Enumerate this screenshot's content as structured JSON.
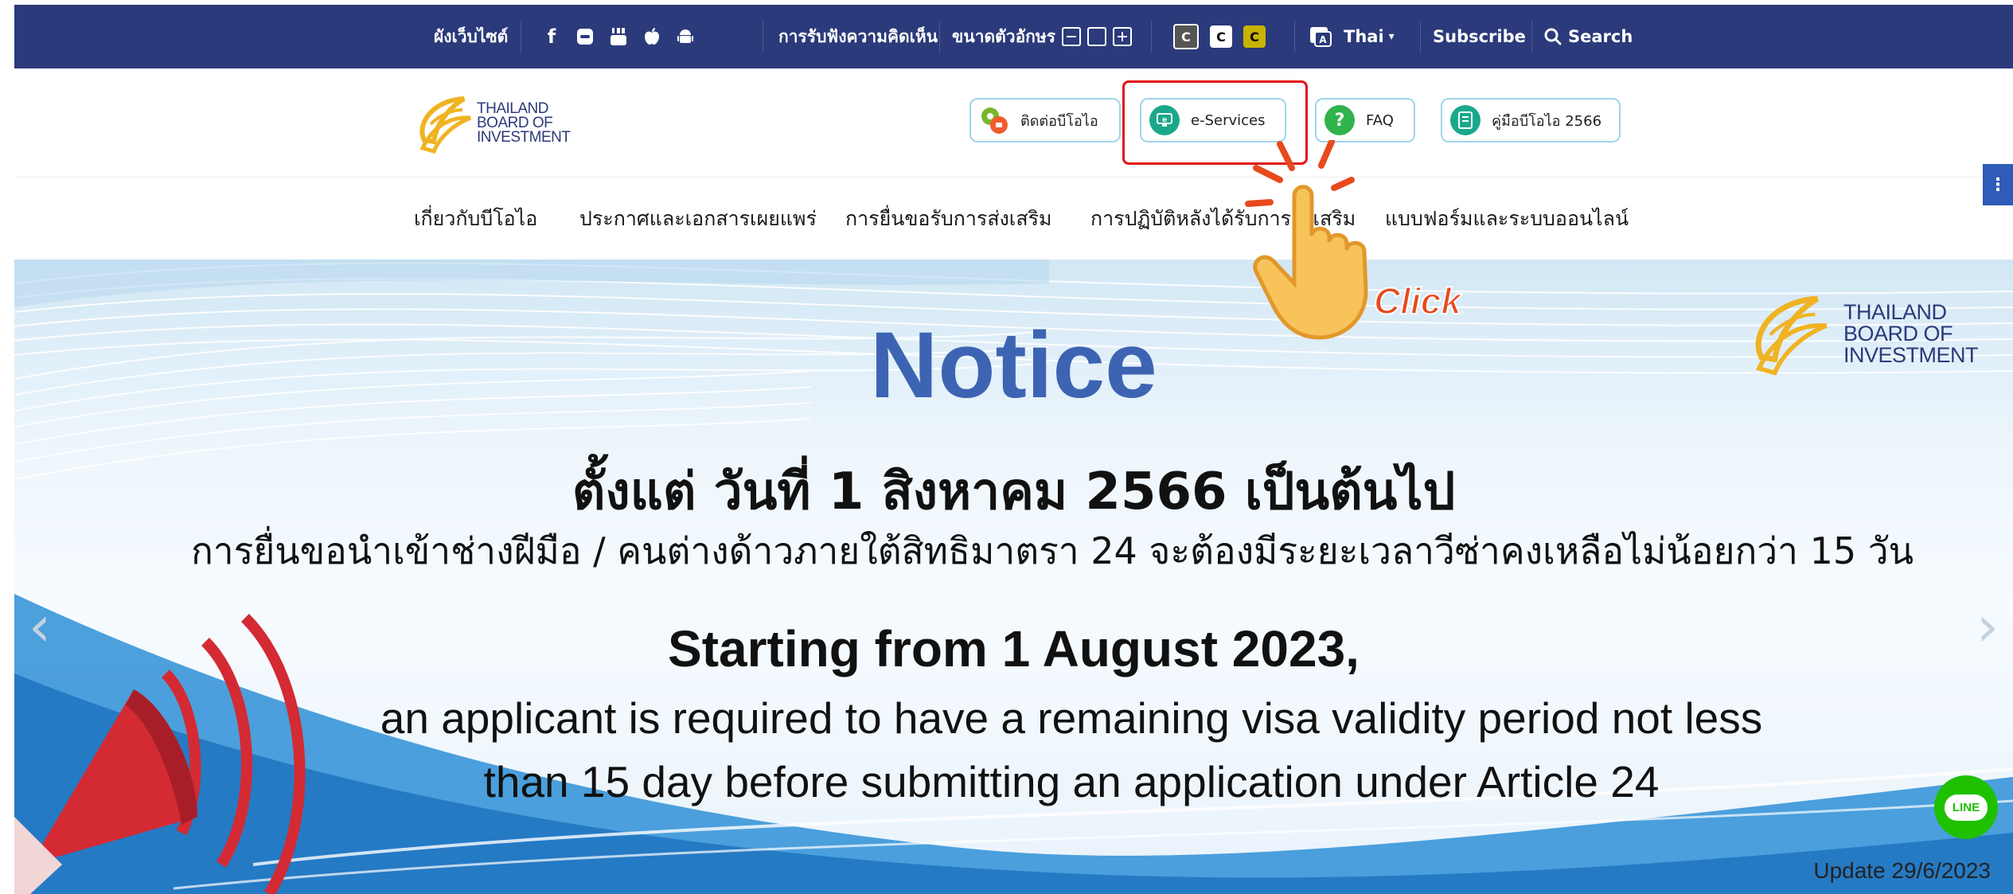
{
  "topbar": {
    "sitemap": "ผังเว็บไซต์",
    "feedback": "การรับฟังความคิดเห็น",
    "font_size_label": "ขนาดตัวอักษร",
    "contrast_options": [
      "C",
      "C",
      "C"
    ],
    "language": "Thai",
    "subscribe": "Subscribe",
    "search": "Search"
  },
  "header": {
    "logo_lines": [
      "THAILAND",
      "BOARD OF",
      "INVESTMENT"
    ],
    "quick_links": [
      "ติดต่อบีโอไอ",
      "e-Services",
      "FAQ",
      "คู่มือบีโอไอ 2566"
    ]
  },
  "nav": {
    "items": [
      "เกี่ยวกับบีโอไอ",
      "ประกาศและเอกสารเผยแพร่",
      "การยื่นขอรับการส่งเสริม",
      "การปฏิบัติหลังได้รับการส่งเสริม",
      "แบบฟอร์มและระบบออนไลน์"
    ]
  },
  "overlay": {
    "click_label": "Click!"
  },
  "banner": {
    "title": "Notice",
    "thai_heading": "ตั้งแต่ วันที่ 1 สิงหาคม 2566 เป็นต้นไป",
    "thai_body": "การยื่นขอนำเข้าช่างฝีมือ / คนต่างด้าวภายใต้สิทธิมาตรา 24 จะต้องมีระยะเวลาวีซ่าคงเหลือไม่น้อยกว่า 15 วัน",
    "en_heading": "Starting from 1 August 2023,",
    "en_body_1": "an applicant is required to have a remaining visa validity period not less",
    "en_body_2": "than 15 day before submitting an application under Article 24",
    "update": "Update 29/6/2023",
    "line_label": "LINE",
    "logo_lines": [
      "THAILAND",
      "BOARD OF",
      "INVESTMENT"
    ]
  },
  "colors": {
    "topbar_bg": "#2b3a7a",
    "accent_blue": "#3d64b3",
    "highlight_red": "#e3131b",
    "line_green": "#1fc000",
    "logo_gold": "#f0b323"
  }
}
